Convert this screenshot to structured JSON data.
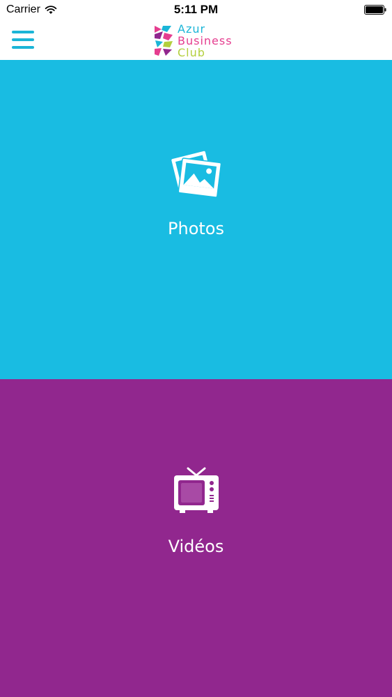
{
  "status_bar": {
    "carrier": "Carrier",
    "time": "5:11 PM",
    "wifi_icon": "wifi-icon",
    "battery_icon": "battery-icon"
  },
  "nav": {
    "menu_icon": "hamburger-menu-icon",
    "logo": {
      "line1": "Azur",
      "line2": "Business",
      "line3": "Club"
    },
    "accent_color": "#1bb5d7"
  },
  "tiles": [
    {
      "label": "Photos",
      "icon": "photos-icon",
      "background": "#19bce2"
    },
    {
      "label": "Vidéos",
      "icon": "tv-icon",
      "background": "#91278e"
    }
  ]
}
